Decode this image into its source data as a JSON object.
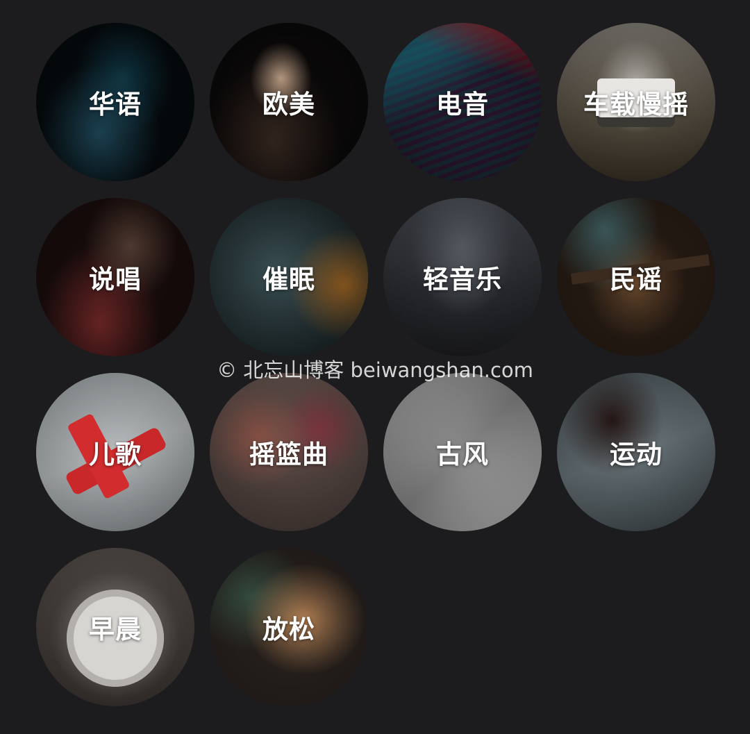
{
  "categories": [
    {
      "label": "华语",
      "icon": "mandopop-cover"
    },
    {
      "label": "欧美",
      "icon": "western-cover"
    },
    {
      "label": "电音",
      "icon": "electronic-cover"
    },
    {
      "label": "车载慢摇",
      "icon": "car-cover"
    },
    {
      "label": "说唱",
      "icon": "rap-cover"
    },
    {
      "label": "催眠",
      "icon": "hypnosis-cover"
    },
    {
      "label": "轻音乐",
      "icon": "light-music-cover"
    },
    {
      "label": "民谣",
      "icon": "folk-cover"
    },
    {
      "label": "儿歌",
      "icon": "kids-cover"
    },
    {
      "label": "摇篮曲",
      "icon": "lullaby-cover"
    },
    {
      "label": "古风",
      "icon": "ancient-style-cover"
    },
    {
      "label": "运动",
      "icon": "sports-cover"
    },
    {
      "label": "早晨",
      "icon": "morning-cover"
    },
    {
      "label": "放松",
      "icon": "relax-cover"
    }
  ],
  "watermark": "© 北忘山博客 beiwangshan.com",
  "colors": {
    "background": "#1c1b1d",
    "label": "#ffffff"
  }
}
